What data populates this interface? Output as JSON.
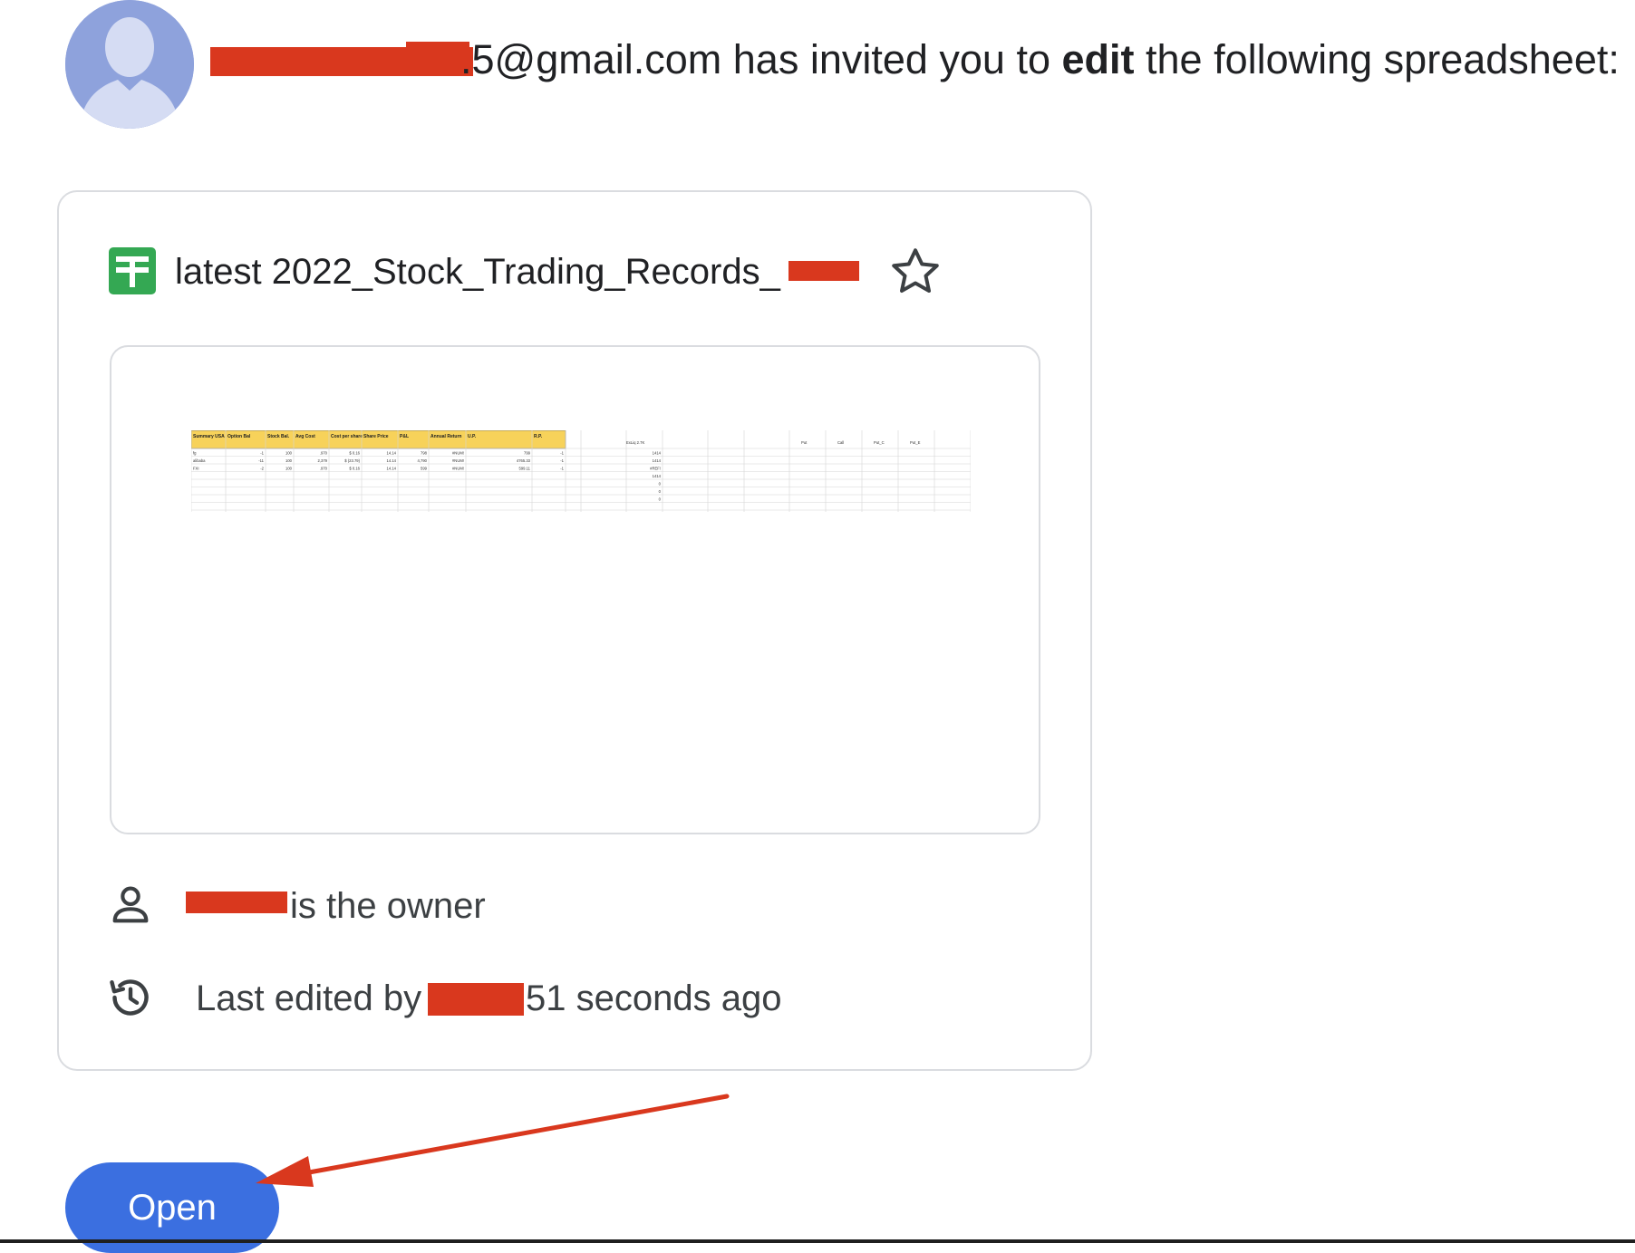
{
  "invite": {
    "email_visible": ".5@gmail.com",
    "before_bold": " has invited you to ",
    "bold": "edit",
    "after_bold": " the following spreadsheet:"
  },
  "file": {
    "title": "latest 2022_Stock_Trading_Records_",
    "icon": "google-sheets-icon",
    "star_icon": "star-outline-icon"
  },
  "preview": {
    "headers": [
      "Summary USA",
      "Option Bal",
      "Stock Bal.",
      "Avg Cost",
      "Cost per share",
      "Share Price",
      "P&L",
      "Annual Return",
      "U.P.",
      "R.P."
    ],
    "rows": [
      [
        "fg",
        "-1",
        "100",
        ".970",
        "$ 0.16",
        "14.14",
        "798",
        "#NUM!",
        "799",
        "-1"
      ],
      [
        "alibaba",
        "-11",
        "100",
        "2,379",
        "$ (23.79)",
        "14.14",
        "4,790",
        "#NUM!",
        "4765.33",
        "-1"
      ],
      [
        "FXI",
        "-2",
        "100",
        ".970",
        "$ 0.16",
        "14.14",
        "599",
        "#NUM!",
        "599.11",
        "-1"
      ]
    ],
    "side_label": "ExLiq 2.7K",
    "side_values": [
      "1414",
      "1414",
      "#REF!",
      "1414",
      "0",
      "0",
      "0"
    ],
    "right_headers": [
      "Put",
      "Call",
      "Put_C",
      "Put_E"
    ]
  },
  "owner": {
    "text": "is the owner",
    "icon": "person-icon"
  },
  "last_edited": {
    "prefix": "Last edited by",
    "suffix": "51 seconds ago",
    "icon": "history-icon"
  },
  "actions": {
    "open_label": "Open"
  },
  "colors": {
    "button_blue": "#3b6fe0",
    "sheets_green": "#34a853",
    "redaction_red": "#d9381e",
    "header_yellow": "#f7d25a",
    "avatar_blue": "#8ea2dc"
  }
}
